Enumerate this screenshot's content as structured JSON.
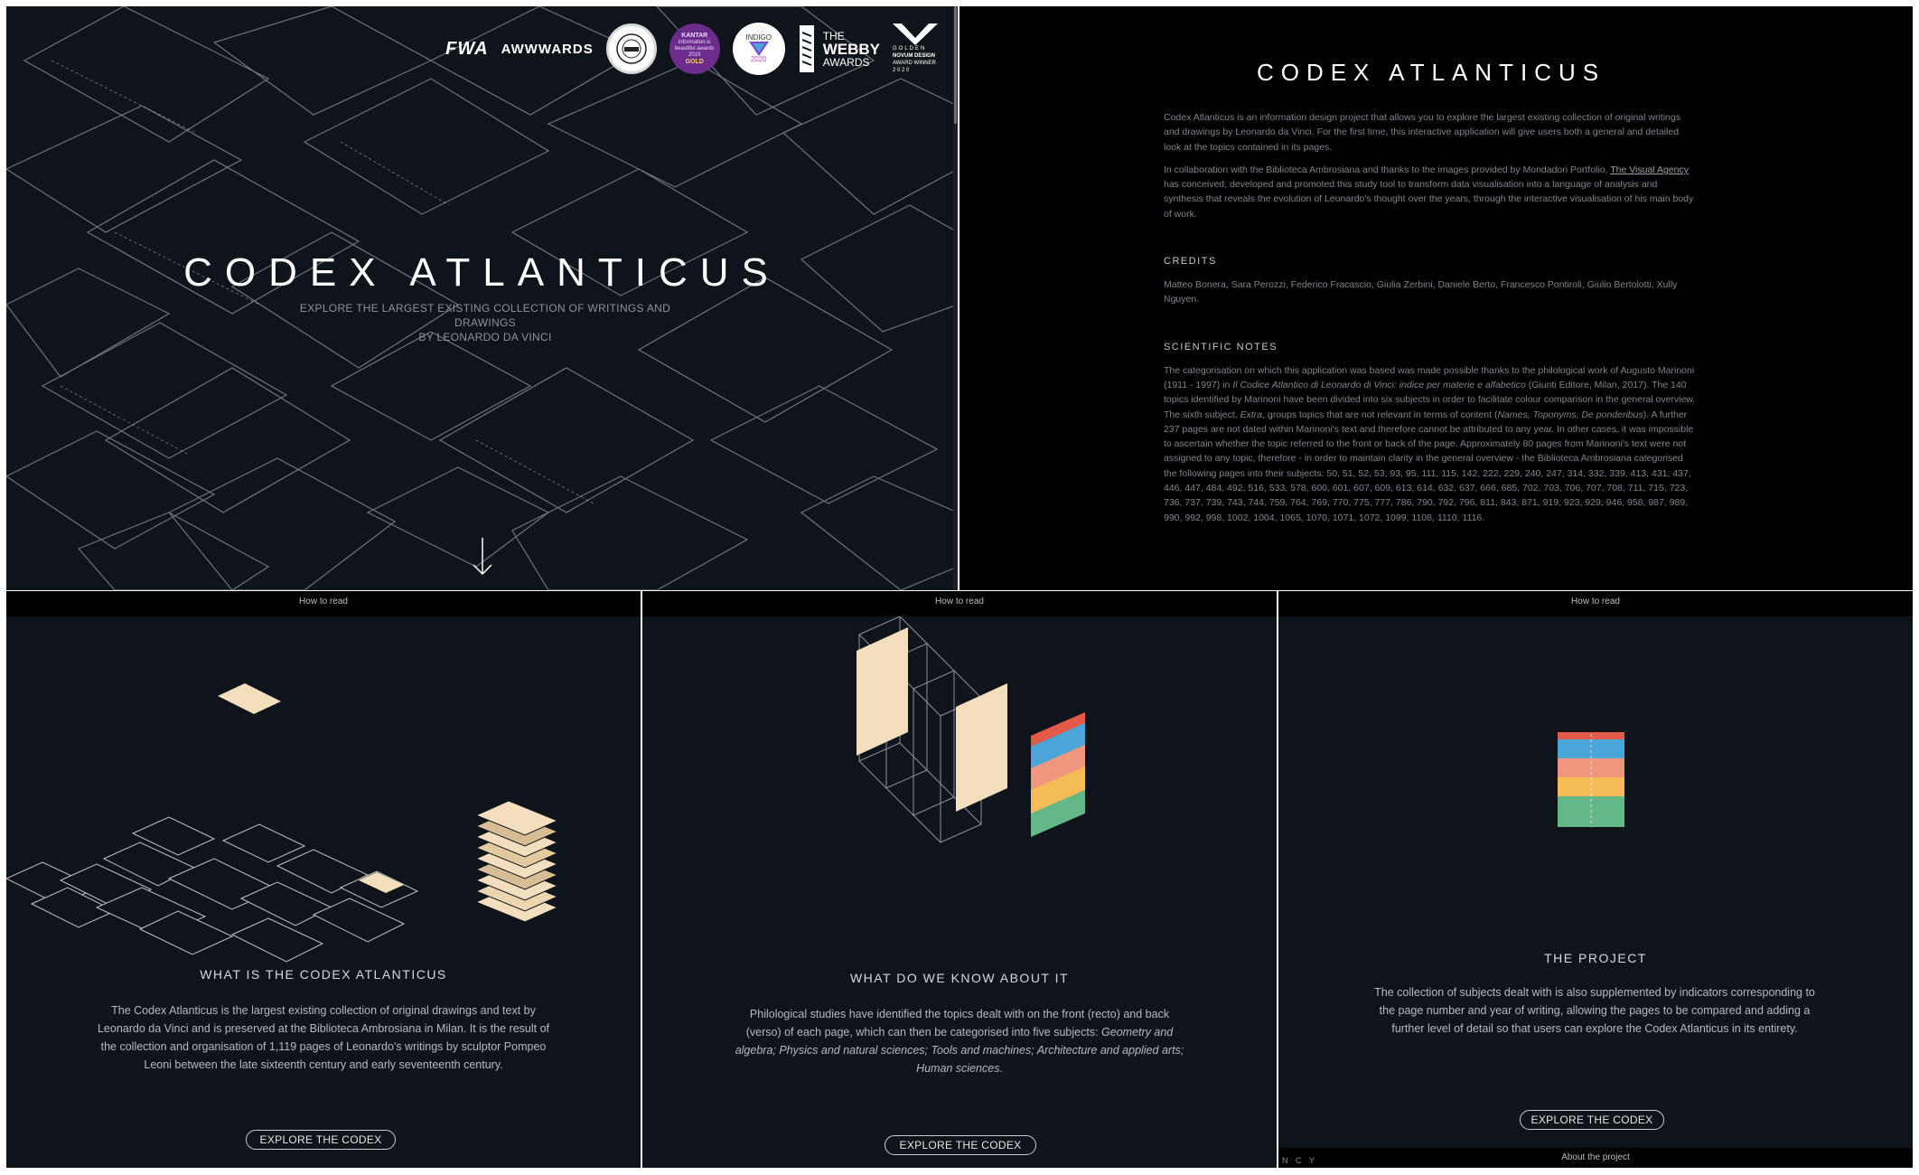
{
  "hero": {
    "title": "CODEX ATLANTICUS",
    "subtitle_line1": "EXPLORE THE LARGEST EXISTING COLLECTION OF WRITINGS AND DRAWINGS",
    "subtitle_line2": "BY LEONARDO DA VINCI",
    "awards": {
      "fwa": "FWA",
      "awwwards": "AWWWARDS",
      "kantar_title": "KANTAR",
      "kantar_text": "information is beautiful awards 2019",
      "kantar_level": "GOLD",
      "indigo": "INDIGO",
      "indigo_year": "2020",
      "webby_line1": "THE",
      "webby_line2": "WEBBY",
      "webby_line3": "AWARDS",
      "novum_line1": "GOLDEN",
      "novum_line2": "NOVUM DESIGN",
      "novum_line3": "AWARD WINNER",
      "novum_year": "2 0 2 0"
    }
  },
  "about": {
    "title": "CODEX ATLANTICUS",
    "intro": "Codex Atlanticus is an information design project that allows you to explore the largest existing collection of original writings and drawings by Leonardo da Vinci. For the first time, this interactive application will give users both a general and detailed look at the topics contained in its pages.",
    "collab_before": "In collaboration with the Biblioteca Ambrosiana and thanks to the images provided by Mondadori Portfolio,",
    "collab_link": "The Visual Agency",
    "collab_after": "has conceived, developed and promoted this study tool to transform data visualisation into a language of analysis and synthesis that reveals the evolution of Leonardo's thought over the years, through the interactive visualisation of his main body of work.",
    "credits_heading": "CREDITS",
    "credits_text": "Matteo Bonera, Sara Perozzi, Federico Fracascio, Giulia Zerbini, Daniele Berto, Francesco Pontiroli, Giulio Bertolotti, Xully Nguyen.",
    "notes_heading": "SCIENTIFIC NOTES",
    "notes_1": "The categorisation on which this application was based was made possible thanks to the philological work of Augusto Marinoni (1911 - 1997) in",
    "notes_book": "Il Codice Atlantico di Leonardo di Vinci: indice per materie e alfabetico",
    "notes_2": "(Giunti Editore, Milan, 2017). The 140 topics identified by Marinoni have been divided into six subjects in order to facilitate colour comparison in the general overview. The sixth subject,",
    "notes_extra": "Extra",
    "notes_3": ", groups topics that are not relevant in terms of content (",
    "notes_names": "Names, Toponyms, De ponderibus",
    "notes_4": "). A further 237 pages are not dated within Marinoni's text and therefore cannot be attributed to any year. In other cases, it was impossible to ascertain whether the topic referred to the front or back of the page. Approximately 80 pages from Marinoni's text were not assigned to any topic, therefore - in order to maintain clarity in the general overview - the Biblioteca Ambrosiana categorised the following pages into their subjects: 50, 51, 52, 53, 93, 95, 111, 115, 142, 222, 229, 240, 247, 314, 332, 339, 413, 431, 437, 446, 447, 484, 492, 516, 533, 578, 600, 601, 607, 609, 613, 614, 632, 637, 666, 685, 702, 703, 706, 707, 708, 711, 715, 723, 736, 737, 739, 743, 744, 759, 764, 769, 770, 775, 777, 786, 790, 792, 796, 811, 843, 871, 919, 923, 929, 946, 958, 987, 989, 990, 992, 998, 1002, 1004, 1065, 1070, 1071, 1072, 1099, 1108, 1110, 1116."
  },
  "how_to_read": [
    {
      "topbar": "How to read",
      "heading": "WHAT IS THE CODEX ATLANTICUS",
      "text": "The Codex Atlanticus is the largest existing collection of original drawings and text by Leonardo da Vinci and is preserved at the Biblioteca Ambrosiana in Milan. It is the result of the collection and organisation of 1,119 pages of Leonardo's writings by sculptor Pompeo Leoni between the late sixteenth century and early seventeenth century.",
      "button": "EXPLORE THE CODEX"
    },
    {
      "topbar": "How to read",
      "heading": "WHAT DO WE KNOW ABOUT IT",
      "text_plain": "Philological studies have identified the topics dealt with on the front (recto) and back (verso) of each page, which can then be categorised into five subjects:",
      "text_italic": "Geometry and algebra; Physics and natural sciences; Tools and machines; Architecture and applied arts; Human sciences.",
      "button": "EXPLORE THE CODEX"
    },
    {
      "topbar": "How to read",
      "heading": "THE PROJECT",
      "text": "The collection of subjects dealt with is also supplemented by indicators corresponding to the page number and year of writing, allowing the pages to be compared and adding a further level of detail so that users can explore the Codex Atlanticus in its entirety.",
      "button": "EXPLORE THE CODEX",
      "bottombar": "About the project",
      "bottom_left": "N C Y"
    }
  ],
  "colors": {
    "page_cream": "#f3dfbd",
    "subject_red": "#e35a4b",
    "subject_blue": "#4aa6d8",
    "subject_salmon": "#f0967f",
    "subject_yellow": "#f5bb57",
    "subject_green": "#64b887",
    "kantar_purple": "#6b2c8c"
  },
  "icons": {
    "scroll_arrow": "arrow-down-icon"
  }
}
